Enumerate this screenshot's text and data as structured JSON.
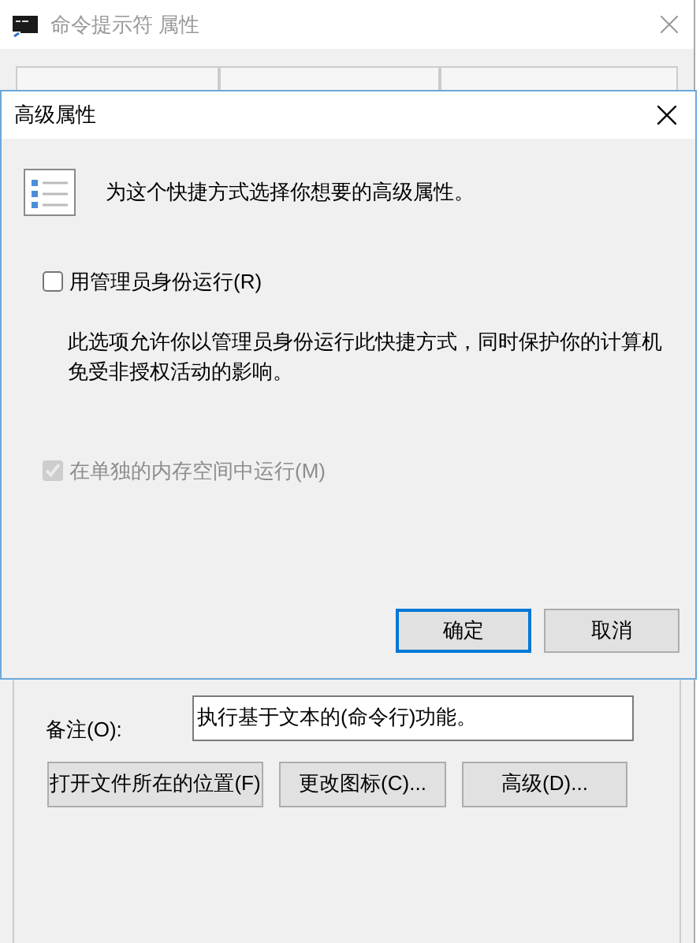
{
  "background_window": {
    "title": "命令提示符 属性",
    "comment": {
      "label": "备注(O):",
      "value": "执行基于文本的(命令行)功能。"
    },
    "buttons": [
      "打开文件所在的位置(F)",
      "更改图标(C)...",
      "高级(D)..."
    ]
  },
  "dialog": {
    "title": "高级属性",
    "intro": "为这个快捷方式选择你想要的高级属性。",
    "options": [
      {
        "label": "用管理员身份运行(R)",
        "checked": false,
        "disabled": false,
        "description": "此选项允许你以管理员身份运行此快捷方式，同时保护你的计算机免受非授权活动的影响。"
      },
      {
        "label": "在单独的内存空间中运行(M)",
        "checked": true,
        "disabled": true
      }
    ],
    "buttons": [
      {
        "label": "确定",
        "default": true
      },
      {
        "label": "取消",
        "default": false
      }
    ]
  }
}
